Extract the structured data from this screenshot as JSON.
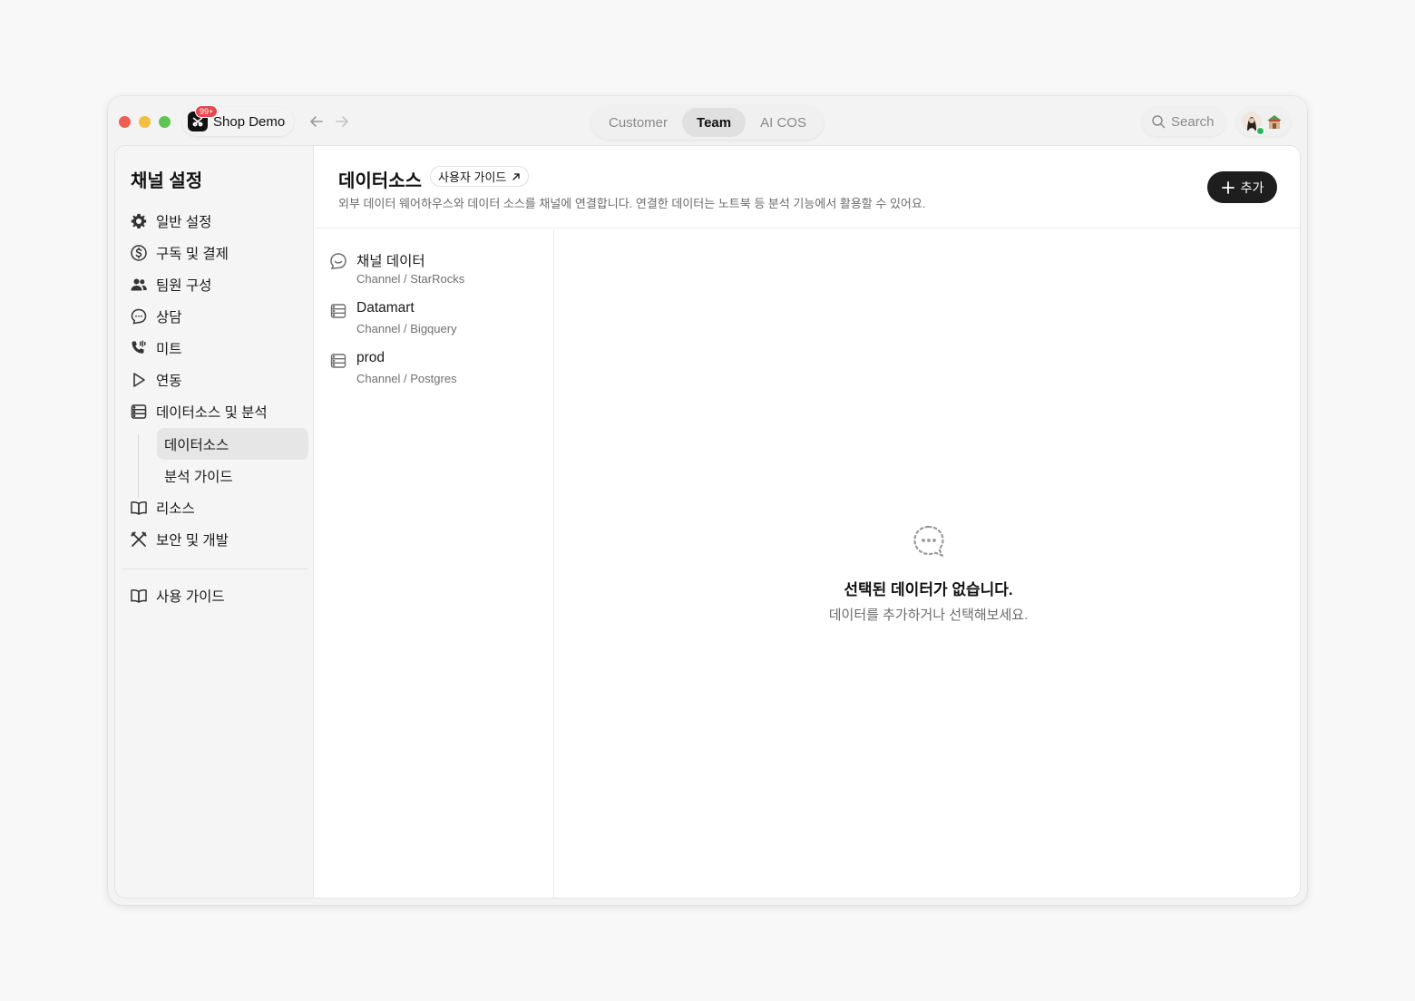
{
  "titlebar": {
    "channel_name": "Shop Demo",
    "badge": "99+",
    "tabs": [
      {
        "label": "Customer",
        "active": false
      },
      {
        "label": "Team",
        "active": true
      },
      {
        "label": "AI COS",
        "active": false
      }
    ],
    "search_label": "Search"
  },
  "sidebar": {
    "title": "채널 설정",
    "items": [
      {
        "label": "일반 설정",
        "icon": "gear-icon"
      },
      {
        "label": "구독 및 결제",
        "icon": "dollar-circle-icon"
      },
      {
        "label": "팀원 구성",
        "icon": "people-icon"
      },
      {
        "label": "상담",
        "icon": "chat-bubble-icon"
      },
      {
        "label": "미트",
        "icon": "phone-icon"
      },
      {
        "label": "연동",
        "icon": "play-icon"
      },
      {
        "label": "데이터소스 및 분석",
        "icon": "database-icon"
      }
    ],
    "sub_items": [
      {
        "label": "데이터소스",
        "active": true
      },
      {
        "label": "분석 가이드",
        "active": false
      }
    ],
    "items_after": [
      {
        "label": "리소스",
        "icon": "book-icon"
      },
      {
        "label": "보안 및 개발",
        "icon": "tools-icon"
      }
    ],
    "footer_item": {
      "label": "사용 가이드",
      "icon": "book-icon"
    }
  },
  "header": {
    "title": "데이터소스",
    "guide_label": "사용자 가이드",
    "description": "외부 데이터 웨어하우스와 데이터 소스를 채널에 연결합니다. 연결한 데이터는 노트북 등 분석 기능에서 활용할 수 있어요.",
    "add_label": "추가"
  },
  "datasources": [
    {
      "name": "채널 데이터",
      "sub": "Channel / StarRocks",
      "icon": "channel-logo-icon"
    },
    {
      "name": "Datamart",
      "sub": "Channel / Bigquery",
      "icon": "database-icon"
    },
    {
      "name": "prod",
      "sub": "Channel / Postgres",
      "icon": "database-icon"
    }
  ],
  "empty_state": {
    "title": "선택된 데이터가 없습니다.",
    "description": "데이터를 추가하거나 선택해보세요."
  },
  "colors": {
    "primary_button": "#1e1e1e",
    "badge": "#e5484d",
    "presence": "#2fb35c"
  }
}
